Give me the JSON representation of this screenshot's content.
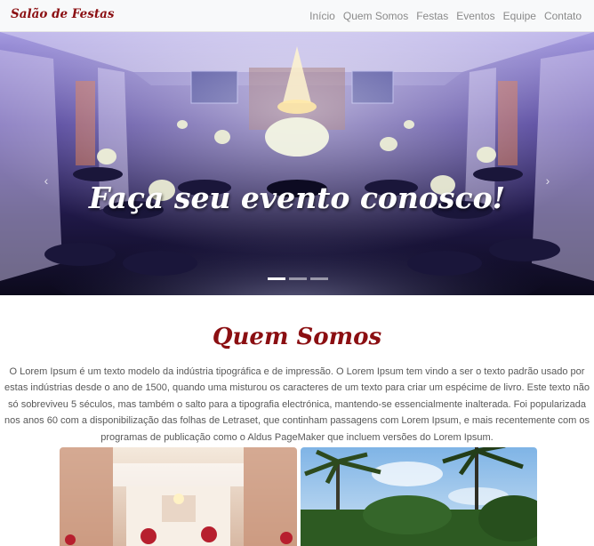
{
  "navbar": {
    "brand": "Salão de Festas",
    "links": [
      "Início",
      "Quem Somos",
      "Festas",
      "Eventos",
      "Equipe",
      "Contato"
    ]
  },
  "hero": {
    "caption": "Faça seu evento conosco!",
    "prev_icon": "‹",
    "next_icon": "›",
    "indicator_count": 3,
    "active_indicator": 1
  },
  "about": {
    "title": "Quem Somos",
    "text": "O Lorem Ipsum é um texto modelo da indústria tipográfica e de impressão. O Lorem Ipsum tem vindo a ser o texto padrão usado por estas indústrias desde o ano de 1500, quando uma misturou os caracteres de um texto para criar um espécime de livro. Este texto não só sobreviveu 5 séculos, mas também o salto para a tipografia electrónica, mantendo-se essencialmente inalterada. Foi popularizada nos anos 60 com a disponibilização das folhas de Letraset, que continham passagens com Lorem Ipsum, e mais recentemente com os programas de publicação como o Aldus PageMaker que incluem versões do Lorem Ipsum."
  },
  "colors": {
    "brand": "#8b0f12",
    "navbar_bg": "#f8f9fa",
    "nav_link": "#8a8a8a"
  }
}
